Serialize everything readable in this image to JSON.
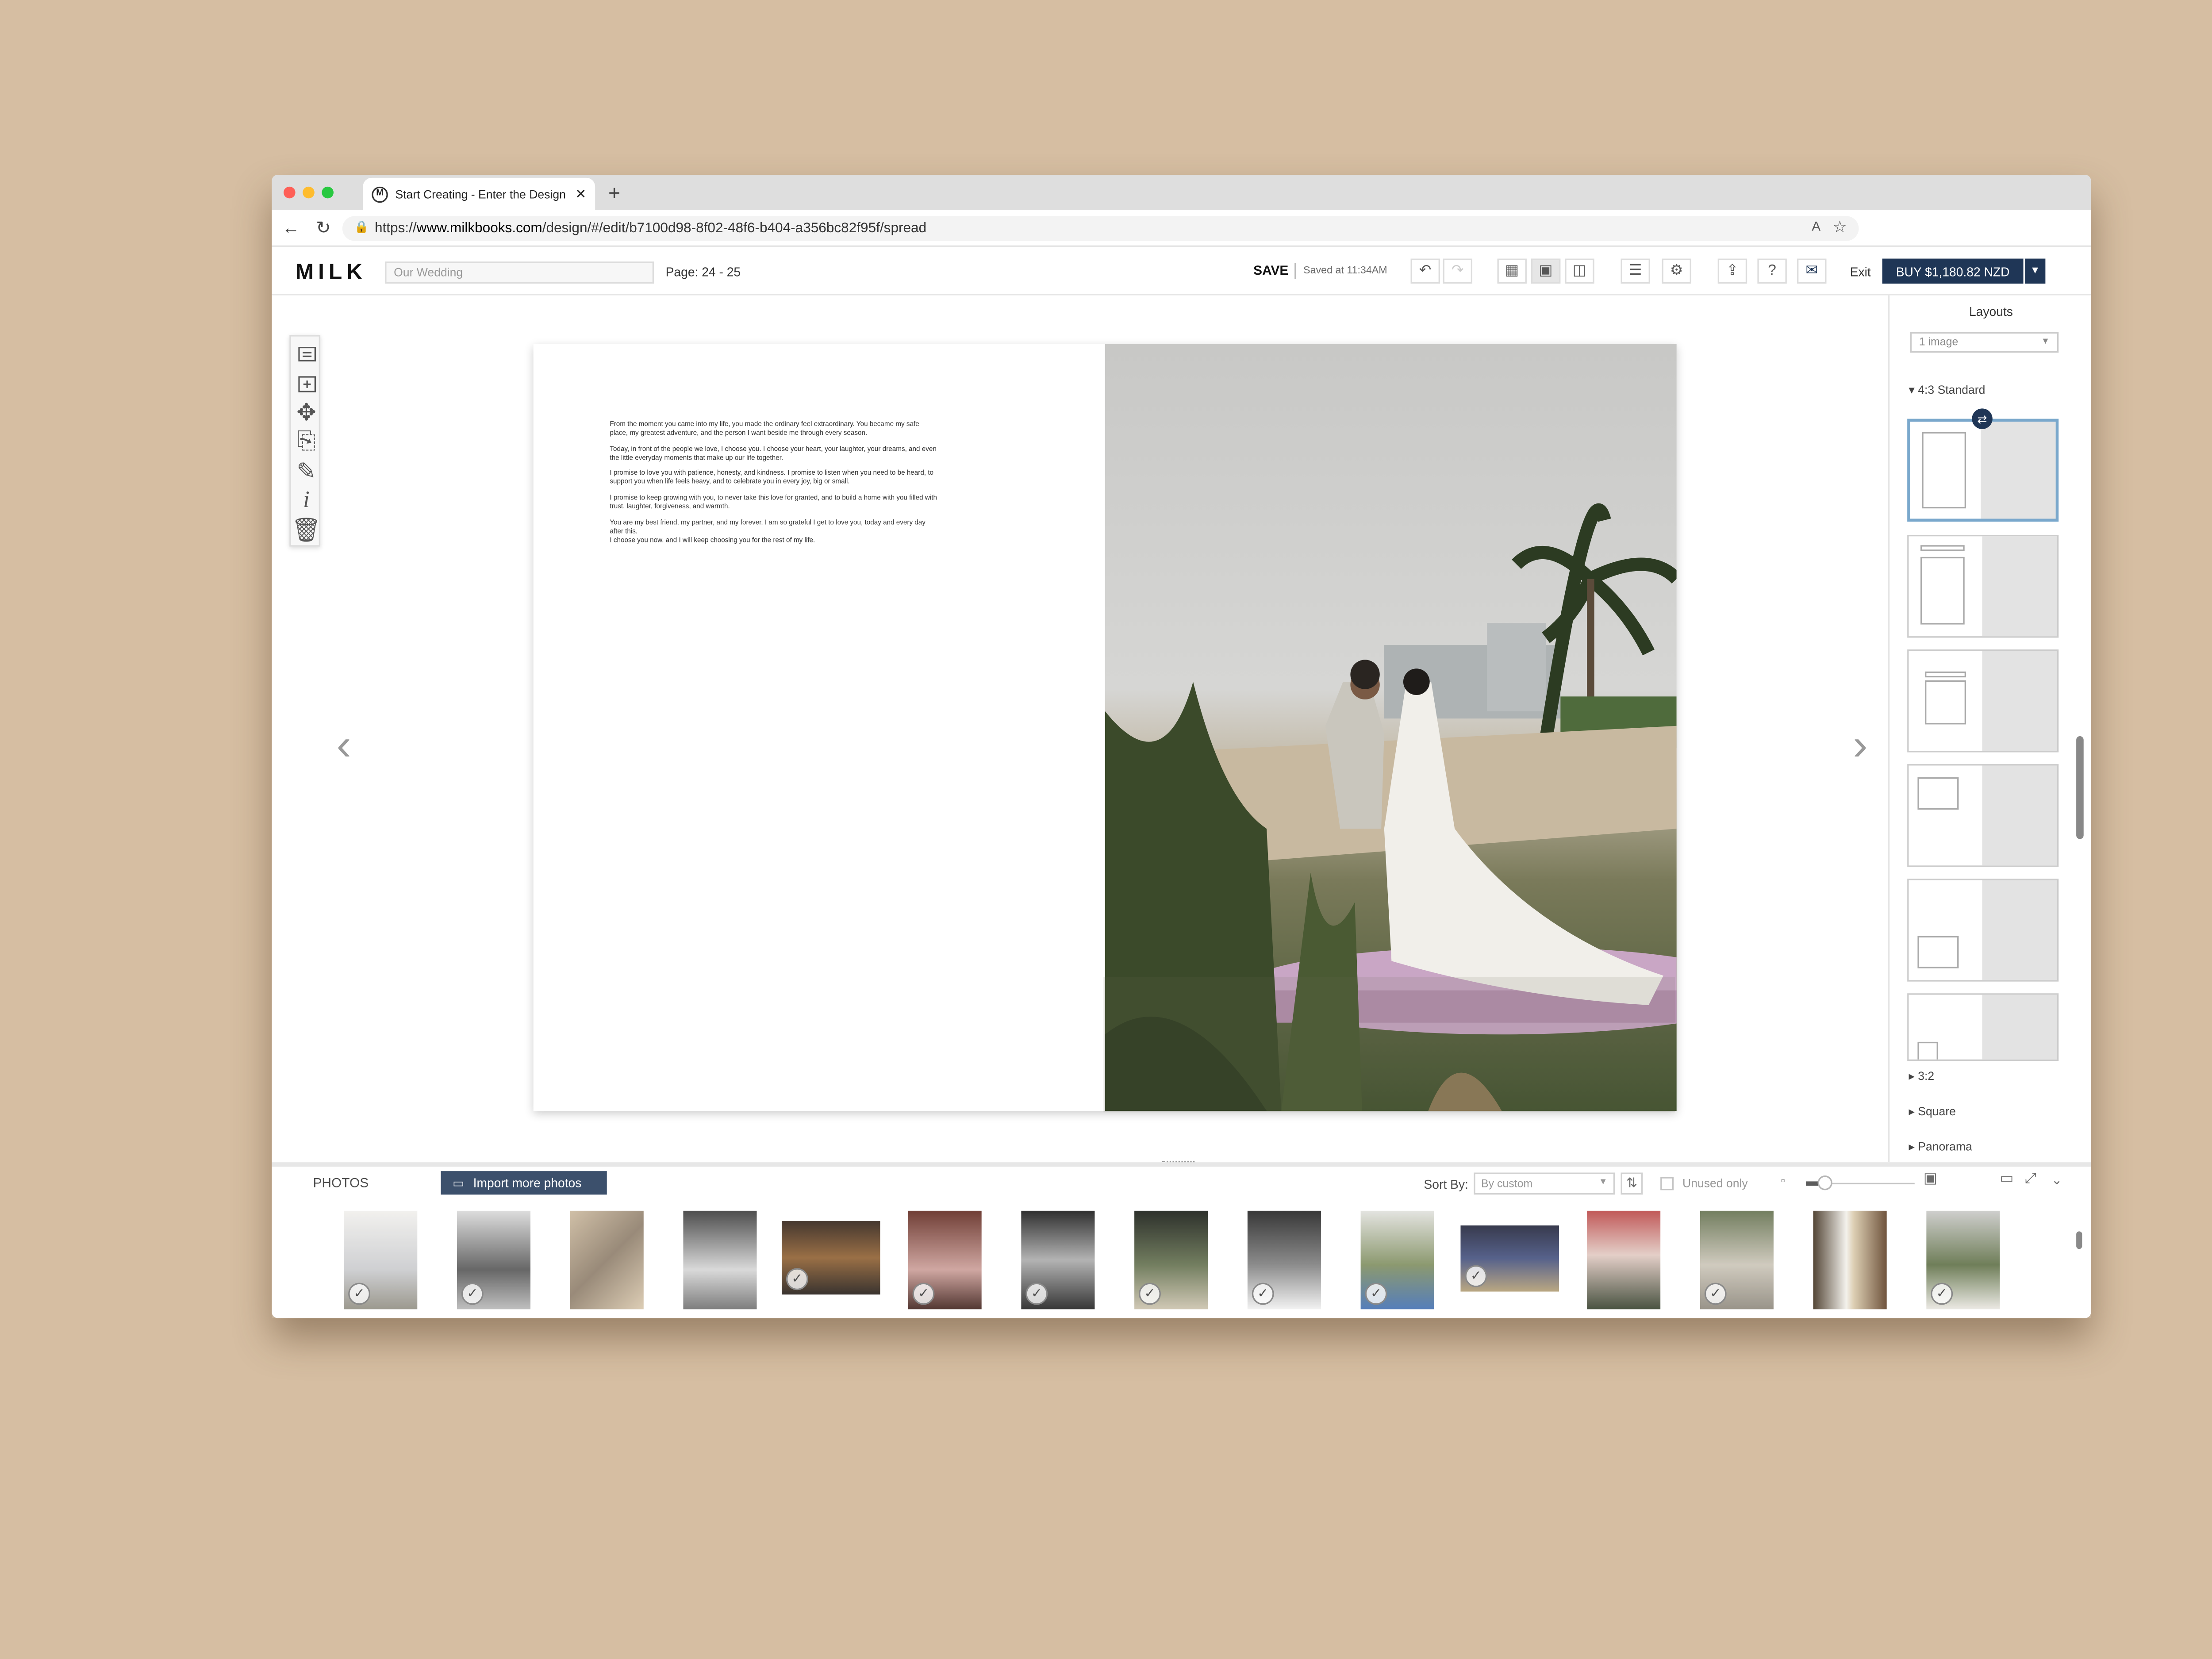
{
  "browser": {
    "tab_title": "Start Creating - Enter the Design",
    "tab_icon": "M",
    "url_prefix": "https://",
    "url_domain": "www.milkbooks.com",
    "url_path": "/design/#/edit/b7100d98-8f02-48f6-b404-a356bc82f95f/spread"
  },
  "toolbar": {
    "logo": "MILK",
    "title_placeholder": "Our Wedding",
    "page_info": "Page: 24 - 25",
    "save_label": "SAVE",
    "saved_status": "Saved at 11:34AM",
    "exit_label": "Exit",
    "buy_label": "BUY $1,180.82 NZD"
  },
  "page_text": [
    "From the moment you came into my life, you made the ordinary feel extraordinary. You became my safe place, my greatest adventure, and the person I want beside me through every season.",
    "Today, in front of the people we love, I choose you. I choose your heart, your laughter, your dreams, and even the little everyday moments that make up our life together.",
    "I promise to love you with patience, honesty, and kindness. I promise to listen when you need to be heard, to support you when life feels heavy, and to celebrate you in every joy, big or small.",
    "I promise to keep growing with you, to never take this love for granted, and to build a home with you filled with trust, laughter, forgiveness, and warmth.",
    "You are my best friend, my partner, and my forever. I am so grateful I get to love you, today and every day after this.",
    "I choose you now, and I will keep choosing you for the rest of my life."
  ],
  "layouts": {
    "title": "Layouts",
    "filter": "1 image",
    "sections": [
      "4:3 Standard",
      "3:2",
      "Square",
      "Panorama"
    ]
  },
  "photos_panel": {
    "tab_label": "PHOTOS",
    "import_label": "Import more photos",
    "sort_label": "Sort By:",
    "sort_value": "By custom",
    "unused_label": "Unused only"
  },
  "colors": {
    "accent": "#1f3656",
    "background": "#d6bea2",
    "selected_layout": "#7aa8cc"
  }
}
